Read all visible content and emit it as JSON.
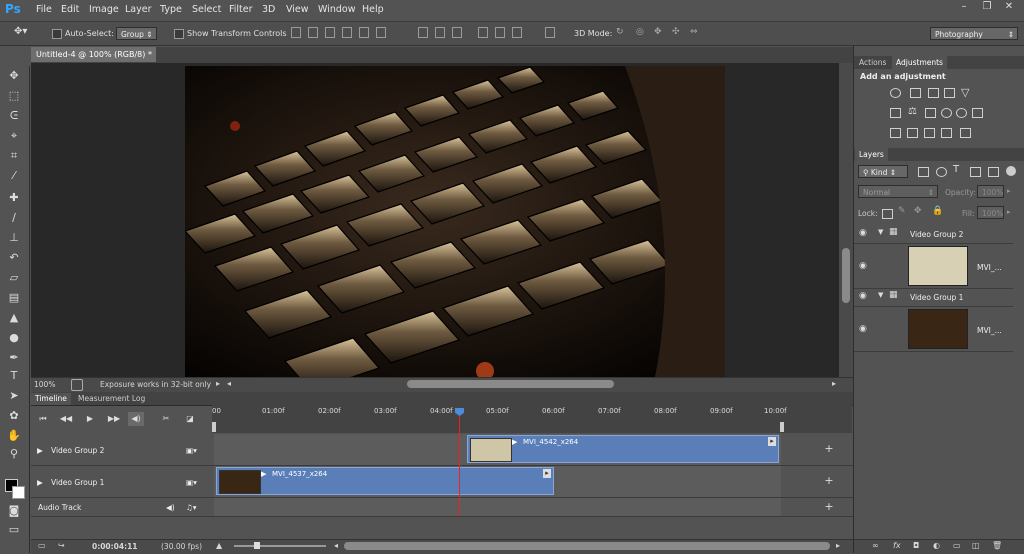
{
  "app": {
    "logo": "Ps",
    "workspace": "Photography"
  },
  "menu": [
    "File",
    "Edit",
    "Image",
    "Layer",
    "Type",
    "Select",
    "Filter",
    "3D",
    "View",
    "Window",
    "Help"
  ],
  "window_controls": {
    "minimize": "–",
    "restore": "❐",
    "close": "✕"
  },
  "options": {
    "auto_select_label": "Auto-Select:",
    "auto_select_value": "Group",
    "transform_label": "Show Transform Controls",
    "mode3d_label": "3D Mode:"
  },
  "document": {
    "tab_title": "Untitled-4 @ 100% (RGB/8) *",
    "zoom": "100%",
    "status_msg": "Exposure works in 32-bit only"
  },
  "timeline": {
    "tabs": [
      "Timeline",
      "Measurement Log"
    ],
    "ruler_ticks": [
      "00",
      "01:00f",
      "02:00f",
      "03:00f",
      "04:00f",
      "05:00f",
      "06:00f",
      "07:00f",
      "08:00f",
      "09:00f",
      "10:00f"
    ],
    "tracks": [
      {
        "label": "Video Group 2",
        "clip": "MVI_4542_x264"
      },
      {
        "label": "Video Group 1",
        "clip": "MVI_4537_x264"
      },
      {
        "label": "Audio Track"
      }
    ],
    "timecode": "0:00:04:11",
    "fps": "(30.00 fps)"
  },
  "panels": {
    "tabs": [
      "Actions",
      "Adjustments"
    ],
    "adjust_title": "Add an adjustment",
    "layers_tab": "Layers",
    "kind_label": "Kind",
    "blend": "Normal",
    "opacity_label": "Opacity:",
    "opacity_value": "100%",
    "lock_label": "Lock:",
    "fill_label": "Fill:",
    "fill_value": "100%",
    "layers": [
      {
        "group": "Video Group 2",
        "name": "MVI_..."
      },
      {
        "group": "Video Group 1",
        "name": "MVI_..."
      }
    ]
  },
  "colors": {
    "clip": "#5a7fb8",
    "playhead": "#e22222",
    "ui_bg": "#535353"
  }
}
